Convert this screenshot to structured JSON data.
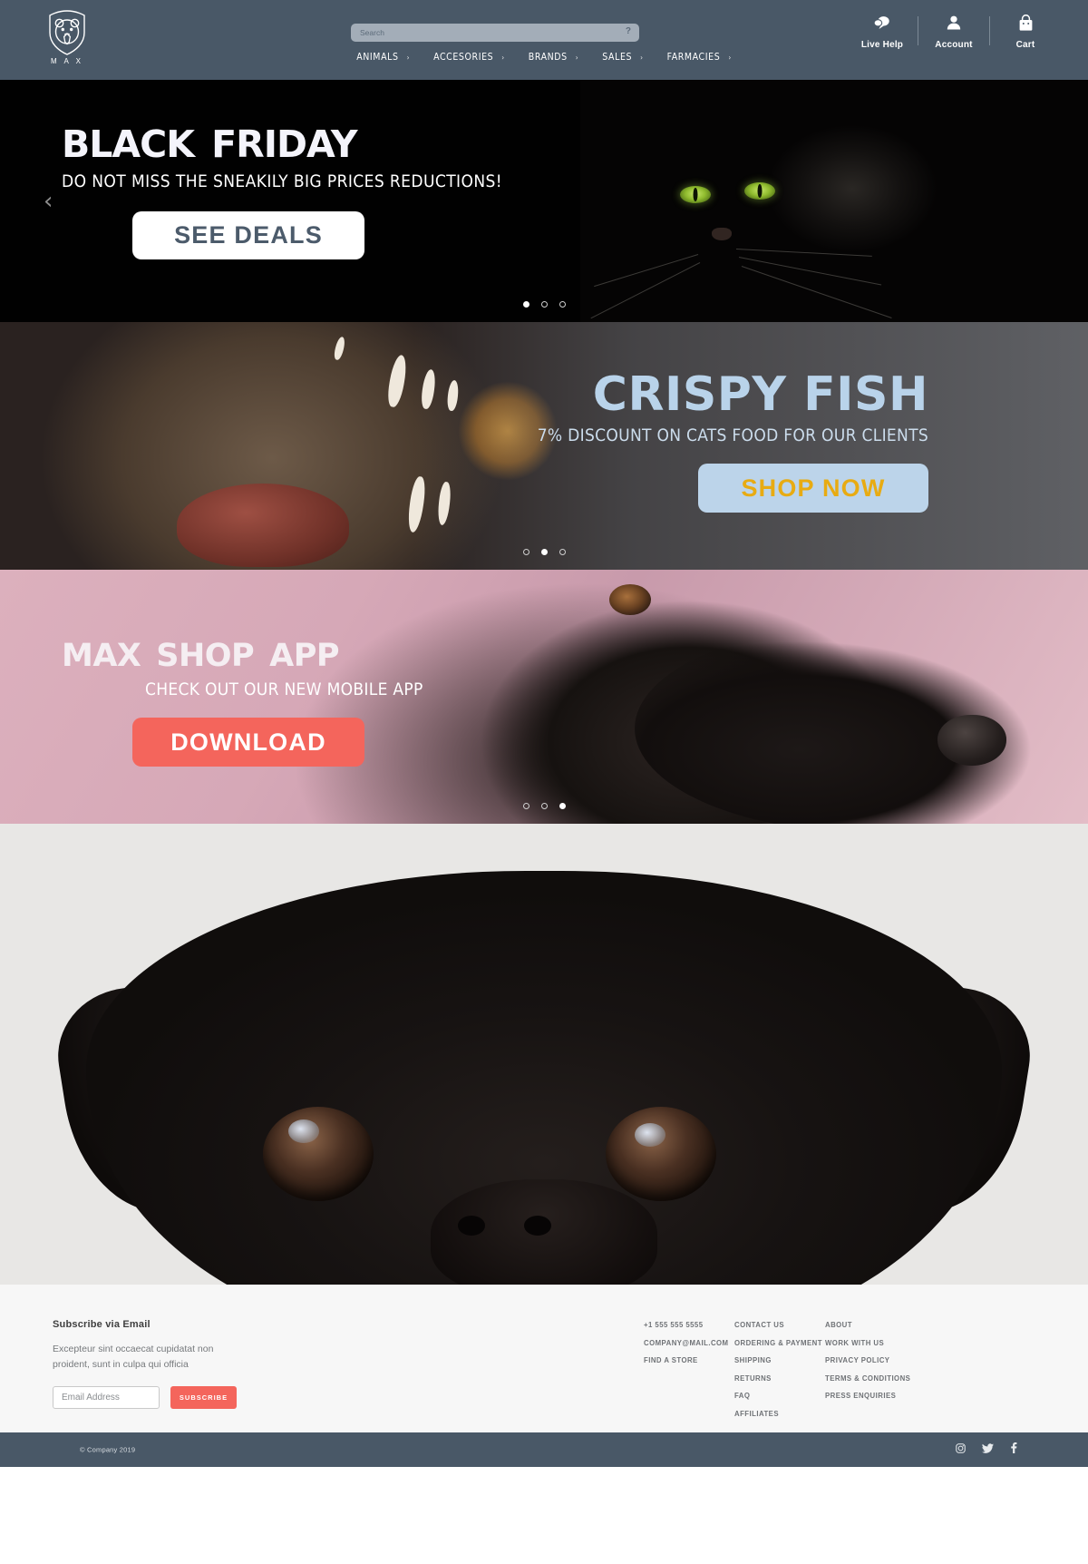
{
  "header": {
    "logo": {
      "icon": "bear-head-shield-icon",
      "wordmark": "M A X"
    },
    "search": {
      "placeholder": "Search",
      "value": "",
      "help_glyph": "?"
    },
    "nav": [
      {
        "label": "ANIMALS",
        "caret": "›"
      },
      {
        "label": "ACCESORIES",
        "caret": "›"
      },
      {
        "label": "BRANDS",
        "caret": "›"
      },
      {
        "label": "SALES",
        "caret": "›"
      },
      {
        "label": "FARMACIES",
        "caret": "›"
      }
    ],
    "utils": [
      {
        "label": "Live Help",
        "icon": "chat-bubble-icon"
      },
      {
        "label": "Account",
        "icon": "person-icon"
      },
      {
        "label": "Cart",
        "icon": "shopping-bag-icon"
      }
    ]
  },
  "banners": [
    {
      "id": "black-friday",
      "title": "Black Friday",
      "subtitle": "DO NOT MISS THE SNEAKILY BIG PRICES REDUCTIONS!",
      "cta": "SEE DEALS",
      "prev_arrow": "‹",
      "dots": [
        true,
        false,
        false
      ]
    },
    {
      "id": "crispy-fish",
      "title": "CRISPY FISH",
      "subtitle": "7% DISCOUNT ON CATS FOOD FOR OUR CLIENTS",
      "cta": "SHOP NOW",
      "dots": [
        false,
        true,
        false
      ]
    },
    {
      "id": "max-shop-app",
      "title": "Max Shop App",
      "subtitle": "CHECK OUT OUR NEW MOBILE APP",
      "cta": "DOWNLOAD",
      "dots": [
        false,
        false,
        true
      ]
    }
  ],
  "footer": {
    "subscribe": {
      "heading": "Subscribe via Email",
      "description": "Excepteur sint occaecat cupidatat non proident, sunt in culpa qui officia",
      "input_placeholder": "Email Address",
      "input_value": "",
      "button": "SUBSCRIBE"
    },
    "columns": [
      {
        "items": [
          "+1 555 555 5555",
          "COMPANY@MAIL.COM",
          "FIND A STORE"
        ]
      },
      {
        "items": [
          "CONTACT US",
          "ORDERING & PAYMENT",
          "SHIPPING",
          "RETURNS",
          "FAQ",
          "AFFILIATES"
        ]
      },
      {
        "items": [
          "ABOUT",
          "WORK WITH US",
          "PRIVACY POLICY",
          "TERMS & CONDITIONS",
          "PRESS ENQUIRIES"
        ]
      }
    ],
    "copyright": "© Company 2019",
    "socials": [
      "instagram-icon",
      "twitter-icon",
      "facebook-icon"
    ]
  },
  "colors": {
    "header_bg": "#495867",
    "accent_red": "#f4655c",
    "accent_gold": "#e8ab12",
    "light_blue": "#bcd4ea",
    "pink": "#d8aebb",
    "footer_bg": "#f7f7f7"
  }
}
